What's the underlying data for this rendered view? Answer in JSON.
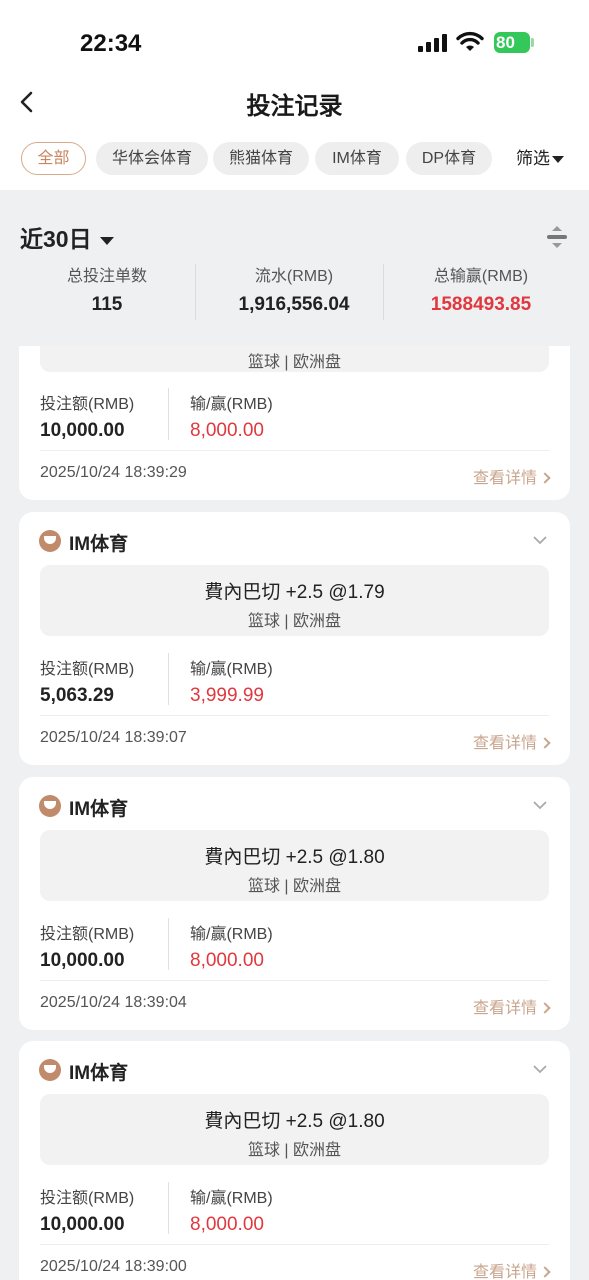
{
  "status_bar": {
    "time": "22:34",
    "battery": "80"
  },
  "header": {
    "title": "投注记录"
  },
  "tabs": [
    {
      "label": "全部",
      "active": true
    },
    {
      "label": "华体会体育",
      "active": false
    },
    {
      "label": "熊猫体育",
      "active": false
    },
    {
      "label": "IM体育",
      "active": false
    },
    {
      "label": "DP体育",
      "active": false
    }
  ],
  "filter_label": "筛选",
  "period": {
    "label": "近30日"
  },
  "summary": {
    "total_bets_label": "总投注单数",
    "total_bets_value": "115",
    "turnover_label": "流水(RMB)",
    "turnover_value": "1,916,556.04",
    "net_label": "总输赢(RMB)",
    "net_value": "1588493.85"
  },
  "labels": {
    "bet_amount": "投注额(RMB)",
    "win_loss": "输/赢(RMB)",
    "view_details": "查看详情"
  },
  "partial_card": {
    "match_sub": "篮球 | 欧洲盘",
    "bet_amount": "10,000.00",
    "win_loss": "8,000.00",
    "time": "2025/10/24 18:39:29"
  },
  "cards": [
    {
      "platform": "IM体育",
      "match_title": "費內巴切 +2.5 @1.79",
      "match_sub": "篮球 | 欧洲盘",
      "bet_amount": "5,063.29",
      "win_loss": "3,999.99",
      "time": "2025/10/24 18:39:07"
    },
    {
      "platform": "IM体育",
      "match_title": "費內巴切 +2.5 @1.80",
      "match_sub": "篮球 | 欧洲盘",
      "bet_amount": "10,000.00",
      "win_loss": "8,000.00",
      "time": "2025/10/24 18:39:04"
    },
    {
      "platform": "IM体育",
      "match_title": "費內巴切 +2.5 @1.80",
      "match_sub": "篮球 | 欧洲盘",
      "bet_amount": "10,000.00",
      "win_loss": "8,000.00",
      "time": "2025/10/24 18:39:00"
    }
  ],
  "colors": {
    "accent": "#c9855f",
    "loss_red": "#e0383e",
    "background": "#eff0f2"
  }
}
